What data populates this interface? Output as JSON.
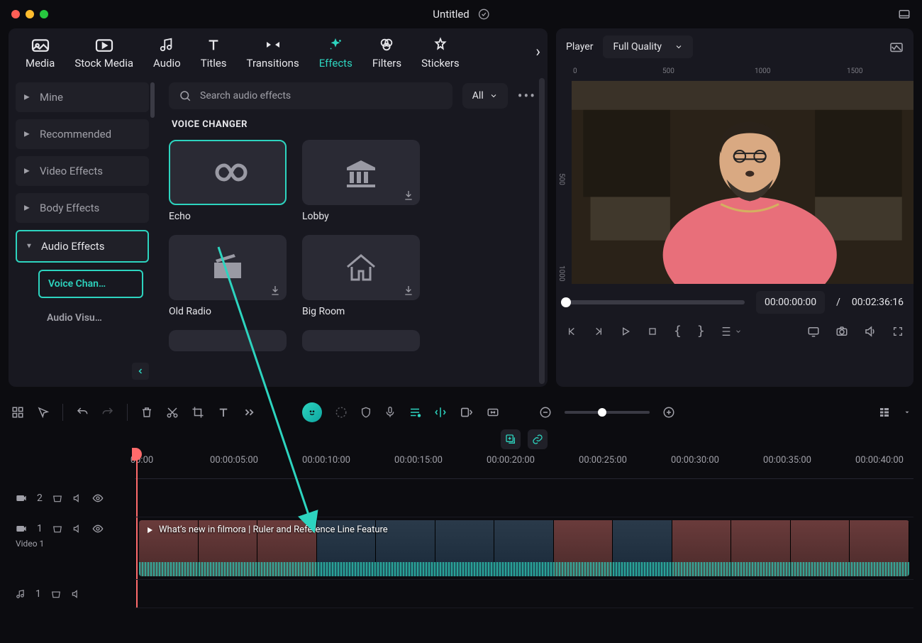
{
  "title": "Untitled",
  "tabs": [
    "Media",
    "Stock Media",
    "Audio",
    "Titles",
    "Transitions",
    "Effects",
    "Filters",
    "Stickers"
  ],
  "active_tab": "Effects",
  "sidebar": {
    "items": [
      "Mine",
      "Recommended",
      "Video Effects",
      "Body Effects",
      "Audio Effects"
    ],
    "expanded": "Audio Effects",
    "sub_items": [
      "Voice Chan…",
      "Audio Visu…"
    ]
  },
  "search": {
    "placeholder": "Search audio effects",
    "filter": "All"
  },
  "section": "VOICE CHANGER",
  "effects": [
    {
      "name": "Echo",
      "icon": "infinity",
      "selected": true,
      "downloadable": false
    },
    {
      "name": "Lobby",
      "icon": "building",
      "selected": false,
      "downloadable": true
    },
    {
      "name": "Old Radio",
      "icon": "radio",
      "selected": false,
      "downloadable": true
    },
    {
      "name": "Big Room",
      "icon": "house",
      "selected": false,
      "downloadable": true
    }
  ],
  "player": {
    "label": "Player",
    "quality": "Full Quality",
    "ruler_x": [
      "0",
      "500",
      "1000",
      "1500"
    ],
    "ruler_y": [
      "500",
      "1000"
    ],
    "current": "00:00:00:00",
    "total": "00:02:36:16",
    "sep": "/"
  },
  "timeline": {
    "ruler": [
      "00:00",
      "00:00:05:00",
      "00:00:10:00",
      "00:00:15:00",
      "00:00:20:00",
      "00:00:25:00",
      "00:00:30:00",
      "00:00:35:00",
      "00:00:40:00"
    ],
    "clip_title": "What’s new in filmora | Ruler and Reference Line Feature",
    "video_track_label": "Video 1",
    "track_b_index": "2",
    "track_v_index": "1",
    "track_a_index": "1"
  }
}
